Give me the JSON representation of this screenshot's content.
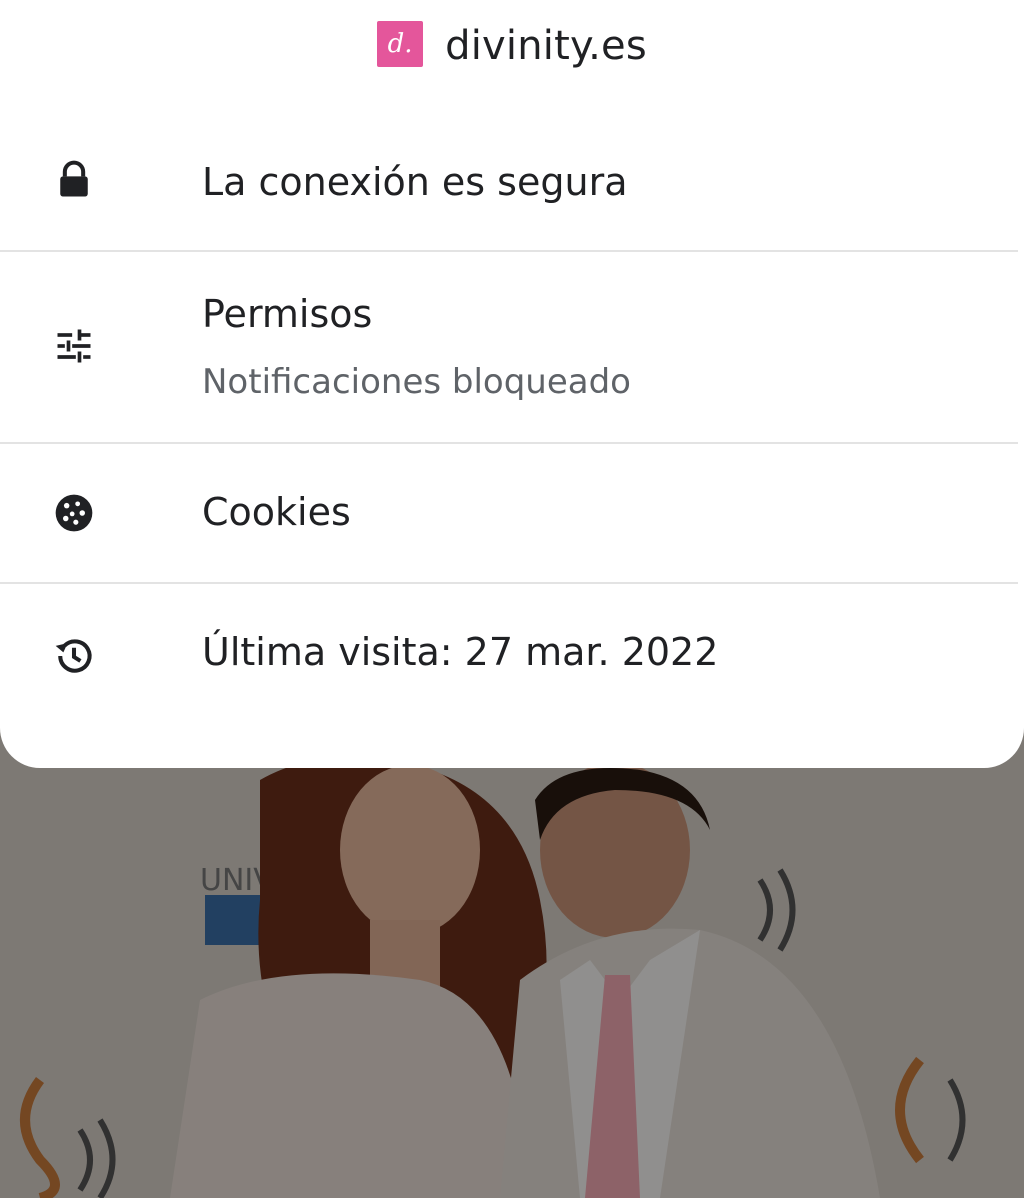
{
  "site": {
    "favicon_letter": "d.",
    "favicon_color": "#e4569b",
    "name": "divinity.es"
  },
  "rows": [
    {
      "icon": "lock-icon",
      "label": "La conexión es segura"
    },
    {
      "icon": "tune-sliders-icon",
      "label": "Permisos",
      "sublabel": "Notificaciones bloqueado"
    },
    {
      "icon": "cookie-icon",
      "label": "Cookies"
    },
    {
      "icon": "history-icon",
      "label": "Última visita: 27 mar. 2022"
    }
  ],
  "background": {
    "scrim_color": "rgba(0,0,0,0.42)"
  }
}
